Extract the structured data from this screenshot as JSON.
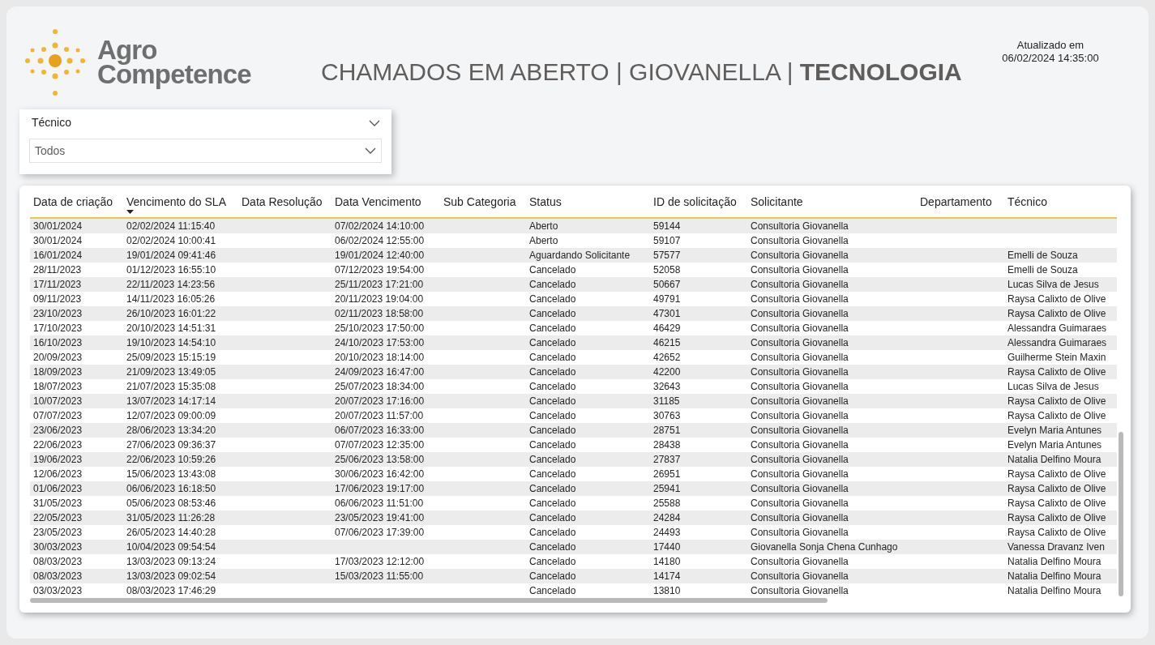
{
  "logo": {
    "line_1": "Agro",
    "line_2": "Competence"
  },
  "title": "CHAMADOS EM ABERTO | GIOVANELLA | **TECNOLOGIA**",
  "updated": {
    "label": "Atualizado em",
    "value": "06/02/2024 14:35:00"
  },
  "slicer": {
    "label": "Técnico",
    "value": "Todos"
  },
  "table": {
    "columns": [
      {
        "label": "Data de criação",
        "sorted": false
      },
      {
        "label": "Vencimento do SLA",
        "sorted": true
      },
      {
        "label": "Data Resolução",
        "sorted": false
      },
      {
        "label": "Data Vencimento",
        "sorted": false
      },
      {
        "label": "Sub Categoria",
        "sorted": false
      },
      {
        "label": "Status",
        "sorted": false
      },
      {
        "label": "ID de solicitação",
        "sorted": false
      },
      {
        "label": "Solicitante",
        "sorted": false
      },
      {
        "label": "Departamento",
        "sorted": false
      },
      {
        "label": "Técnico",
        "sorted": false
      }
    ],
    "rows": [
      [
        "30/01/2024",
        "02/02/2024 11:15:40",
        null,
        "07/02/2024 14:10:00",
        null,
        "Aberto",
        "59144",
        "Consultoria Giovanella",
        null,
        null
      ],
      [
        "30/01/2024",
        "02/02/2024 10:00:41",
        null,
        "06/02/2024 12:55:00",
        null,
        "Aberto",
        "59107",
        "Consultoria Giovanella",
        null,
        null
      ],
      [
        "16/01/2024",
        "19/01/2024 09:41:46",
        null,
        "19/01/2024 12:40:00",
        null,
        "Aguardando Solicitante",
        "57577",
        "Consultoria Giovanella",
        null,
        "Emelli de Souza"
      ],
      [
        "28/11/2023",
        "01/12/2023 16:55:10",
        null,
        "07/12/2023 19:54:00",
        null,
        "Cancelado",
        "52058",
        "Consultoria Giovanella",
        null,
        "Emelli de Souza"
      ],
      [
        "17/11/2023",
        "22/11/2023 14:23:56",
        null,
        "25/11/2023 17:21:00",
        null,
        "Cancelado",
        "50667",
        "Consultoria Giovanella",
        null,
        "Lucas Silva de Jesus"
      ],
      [
        "09/11/2023",
        "14/11/2023 16:05:26",
        null,
        "20/11/2023 19:04:00",
        null,
        "Cancelado",
        "49791",
        "Consultoria Giovanella",
        null,
        "Raysa Calixto de Olive"
      ],
      [
        "23/10/2023",
        "26/10/2023 16:01:22",
        null,
        "02/11/2023 18:58:00",
        null,
        "Cancelado",
        "47301",
        "Consultoria Giovanella",
        null,
        "Raysa Calixto de Olive"
      ],
      [
        "17/10/2023",
        "20/10/2023 14:51:31",
        null,
        "25/10/2023 17:50:00",
        null,
        "Cancelado",
        "46429",
        "Consultoria Giovanella",
        null,
        "Alessandra Guimaraes"
      ],
      [
        "16/10/2023",
        "19/10/2023 14:54:10",
        null,
        "24/10/2023 17:53:00",
        null,
        "Cancelado",
        "46215",
        "Consultoria Giovanella",
        null,
        "Alessandra Guimaraes"
      ],
      [
        "20/09/2023",
        "25/09/2023 15:15:19",
        null,
        "20/10/2023 18:14:00",
        null,
        "Cancelado",
        "42652",
        "Consultoria Giovanella",
        null,
        "Guilherme Stein Maxin"
      ],
      [
        "18/09/2023",
        "21/09/2023 13:49:05",
        null,
        "24/09/2023 16:47:00",
        null,
        "Cancelado",
        "42200",
        "Consultoria Giovanella",
        null,
        "Raysa Calixto de Olive"
      ],
      [
        "18/07/2023",
        "21/07/2023 15:35:08",
        null,
        "25/07/2023 18:34:00",
        null,
        "Cancelado",
        "32643",
        "Consultoria Giovanella",
        null,
        "Lucas Silva de Jesus"
      ],
      [
        "10/07/2023",
        "13/07/2023 14:17:14",
        null,
        "20/07/2023 17:16:00",
        null,
        "Cancelado",
        "31185",
        "Consultoria Giovanella",
        null,
        "Raysa Calixto de Olive"
      ],
      [
        "07/07/2023",
        "12/07/2023 09:00:09",
        null,
        "20/07/2023 11:57:00",
        null,
        "Cancelado",
        "30763",
        "Consultoria Giovanella",
        null,
        "Raysa Calixto de Olive"
      ],
      [
        "23/06/2023",
        "28/06/2023 13:34:20",
        null,
        "06/07/2023 16:33:00",
        null,
        "Cancelado",
        "28751",
        "Consultoria Giovanella",
        null,
        "Evelyn Maria Antunes"
      ],
      [
        "22/06/2023",
        "27/06/2023 09:36:37",
        null,
        "07/07/2023 12:35:00",
        null,
        "Cancelado",
        "28438",
        "Consultoria Giovanella",
        null,
        "Evelyn Maria Antunes"
      ],
      [
        "19/06/2023",
        "22/06/2023 10:59:26",
        null,
        "25/06/2023 13:58:00",
        null,
        "Cancelado",
        "27837",
        "Consultoria Giovanella",
        null,
        "Natalia Delfino Moura"
      ],
      [
        "12/06/2023",
        "15/06/2023 13:43:08",
        null,
        "30/06/2023 16:42:00",
        null,
        "Cancelado",
        "26951",
        "Consultoria Giovanella",
        null,
        "Raysa Calixto de Olive"
      ],
      [
        "01/06/2023",
        "06/06/2023 16:18:50",
        null,
        "17/06/2023 19:17:00",
        null,
        "Cancelado",
        "25941",
        "Consultoria Giovanella",
        null,
        "Raysa Calixto de Olive"
      ],
      [
        "31/05/2023",
        "05/06/2023 08:53:46",
        null,
        "06/06/2023 11:51:00",
        null,
        "Cancelado",
        "25588",
        "Consultoria Giovanella",
        null,
        "Raysa Calixto de Olive"
      ],
      [
        "22/05/2023",
        "31/05/2023 11:26:28",
        null,
        "23/05/2023 19:41:00",
        null,
        "Cancelado",
        "24284",
        "Consultoria Giovanella",
        null,
        "Raysa Calixto de Olive"
      ],
      [
        "23/05/2023",
        "26/05/2023 14:40:28",
        null,
        "07/06/2023 17:39:00",
        null,
        "Cancelado",
        "24493",
        "Consultoria Giovanella",
        null,
        "Raysa Calixto de Olive"
      ],
      [
        "30/03/2023",
        "10/04/2023 09:54:54",
        null,
        null,
        null,
        "Cancelado",
        "17440",
        "Giovanella Sonja Chena Cunhago",
        null,
        "Vanessa Dravanz Iven"
      ],
      [
        "08/03/2023",
        "13/03/2023 09:13:24",
        null,
        "17/03/2023 12:12:00",
        null,
        "Cancelado",
        "14180",
        "Consultoria Giovanella",
        null,
        "Natalia Delfino Moura"
      ],
      [
        "08/03/2023",
        "13/03/2023 09:02:54",
        null,
        "15/03/2023 11:55:00",
        null,
        "Cancelado",
        "14174",
        "Consultoria Giovanella",
        null,
        "Natalia Delfino Moura"
      ],
      [
        "03/03/2023",
        "08/03/2023 17:46:29",
        null,
        null,
        null,
        "Cancelado",
        "13810",
        "Consultoria Giovanella",
        null,
        "Natalia Delfino Moura"
      ]
    ]
  }
}
